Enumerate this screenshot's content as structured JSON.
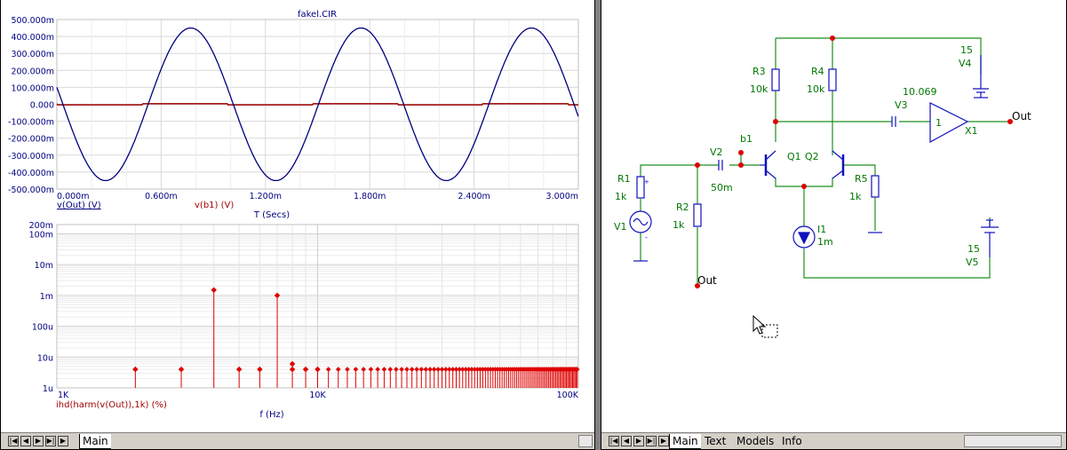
{
  "colors": {
    "voltage_line": "#00007f",
    "signal_line": "#9f0000",
    "harmonic": "#e00000",
    "wire": "#1f8f1f",
    "component": "#1010c0",
    "node": "#e00000",
    "label_green": "#007700"
  },
  "top_chart": {
    "title": "fakel.CIR",
    "y_ticks": [
      "500.000m",
      "400.000m",
      "300.000m",
      "200.000m",
      "100.000m",
      "0.000",
      "-100.000m",
      "-200.000m",
      "-300.000m",
      "-400.000m",
      "-500.000m"
    ],
    "x_ticks": [
      "0.000m",
      "0.600m",
      "1.200m",
      "1.800m",
      "2.400m",
      "3.000m"
    ],
    "legend_vout": "v(Out) (V)",
    "legend_vb1": "v(b1) (V)",
    "xlabel": "T (Secs)"
  },
  "bottom_chart": {
    "y_ticks": [
      "200m",
      "100m",
      "10m",
      "1m",
      "100u",
      "10u",
      "1u"
    ],
    "x_ticks": [
      "1K",
      "10K",
      "100K"
    ],
    "legend": "ihd(harm(v(Out)),1k) (%)",
    "xlabel": "f (Hz)"
  },
  "chart_data": [
    {
      "type": "line",
      "title": "fakel.CIR",
      "xlabel": "T (Secs)",
      "ylabel": "",
      "xlim": [
        0,
        3.0
      ],
      "ylim": [
        -500,
        500
      ],
      "series": [
        {
          "name": "v(Out) (V)",
          "amplitude": 450,
          "frequency_khz": 1,
          "phase_note": "sine, starts near 100m descending"
        },
        {
          "name": "v(b1) (V)",
          "amplitude": 5,
          "frequency_khz": 1
        }
      ]
    },
    {
      "type": "scatter",
      "title": "",
      "xlabel": "f (Hz)",
      "ylabel": "",
      "xlim": [
        1000,
        100000
      ],
      "yscale": "log",
      "series": [
        {
          "name": "ihd(harm(v(Out)),1k) (%)",
          "x": [
            2000,
            3000,
            4000,
            5000,
            6000,
            7000,
            8000,
            9000,
            10000
          ],
          "values": [
            4,
            4,
            1500,
            4,
            4,
            1000,
            4,
            4,
            4
          ]
        }
      ]
    }
  ],
  "schematic": {
    "labels": {
      "r3": "R3",
      "r3v": "10k",
      "r4": "R4",
      "r4v": "10k",
      "v4": "V4",
      "v4v": "15",
      "v3": "V3",
      "v3v": "10.069",
      "x1": "X1",
      "x1g": "1",
      "out": "Out",
      "b1": "b1",
      "v2": "V2",
      "v2v": "50m",
      "q1": "Q1",
      "q2": "Q2",
      "r1": "R1",
      "r1v": "1k",
      "r2": "R2",
      "r2v": "1k",
      "r5": "R5",
      "r5v": "1k",
      "v1": "V1",
      "i1": "I1",
      "i1v": "1m",
      "v5": "V5",
      "v5v": "15",
      "out2": "Out"
    }
  },
  "tabs_left": [
    "Main"
  ],
  "tabs_right": [
    "Main",
    "Text",
    "Models",
    "Info"
  ]
}
